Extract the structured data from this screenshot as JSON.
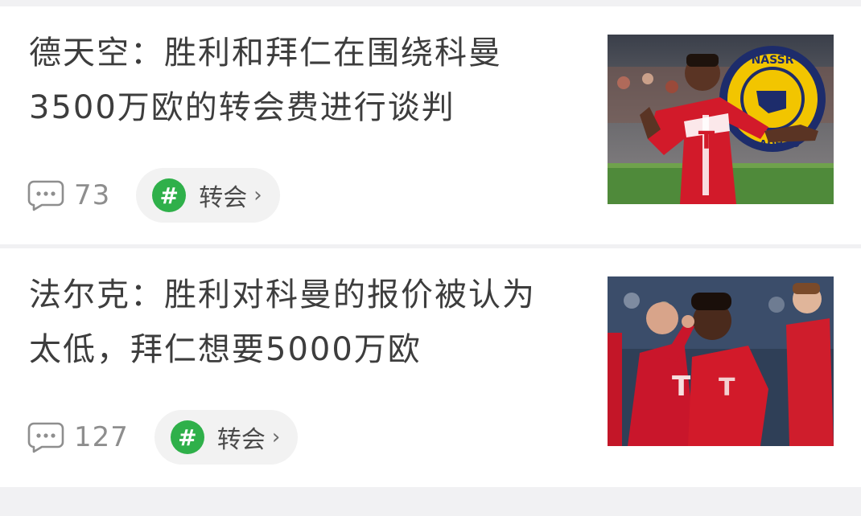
{
  "feed": {
    "items": [
      {
        "title": "德天空：胜利和拜仁在围绕科曼3500万欧的转会费进行谈判",
        "comments": "73",
        "topic": "转会",
        "topic_icon": "hashtag-icon",
        "thumbnail": "player-celebration-nassr-logo"
      },
      {
        "title": "法尔克：胜利对科曼的报价被认为太低，拜仁想要5000万欧",
        "comments": "127",
        "topic": "转会",
        "topic_icon": "hashtag-icon",
        "thumbnail": "team-celebration-photo"
      }
    ]
  },
  "images": {
    "logo_text_top": "NASSR",
    "logo_text_bottom": "ADH 19",
    "jersey_letter": "T"
  },
  "colors": {
    "topic_green": "#2fb04a",
    "bayern_red": "#d21a2a",
    "nassr_yellow": "#f2c500",
    "nassr_blue": "#1d2c6b"
  }
}
